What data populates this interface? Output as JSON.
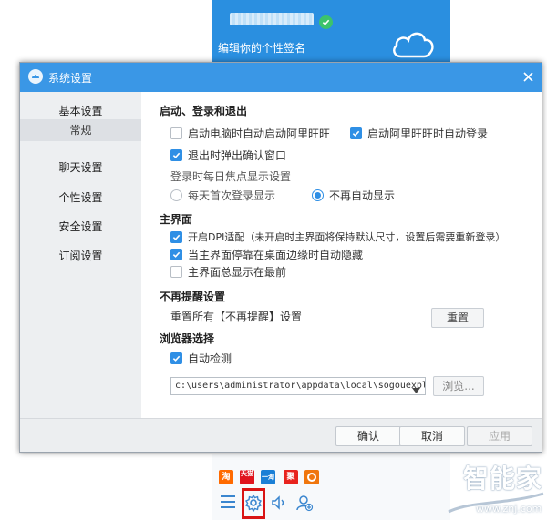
{
  "background": {
    "signature": "编辑你的个性签名",
    "apps": [
      {
        "icon": "taobao-icon",
        "label": "淘",
        "color": "#ff6a00"
      },
      {
        "icon": "tmall-icon",
        "label": "天猫",
        "color": "#e0141e"
      },
      {
        "icon": "xianyu-icon",
        "label": "一淘",
        "color": "#1a7fd6"
      },
      {
        "icon": "juhuasuan-icon",
        "label": "聚",
        "color": "#e8231e"
      },
      {
        "icon": "trip-icon",
        "label": "",
        "color": "#f0760d"
      }
    ],
    "watermark": "智能家",
    "watermark_url": "www.znj.com"
  },
  "dialog": {
    "title": "系统设置",
    "sidebar": [
      {
        "label": "基本设置"
      },
      {
        "label": "常规"
      },
      {
        "label": "聊天设置"
      },
      {
        "label": "个性设置"
      },
      {
        "label": "安全设置"
      },
      {
        "label": "订阅设置"
      }
    ],
    "sections": {
      "startup": {
        "title": "启动、登录和退出",
        "auto_start": {
          "label": "启动电脑时自动启动阿里旺旺",
          "checked": false
        },
        "auto_login": {
          "label": "启动阿里旺旺时自动登录",
          "checked": true
        },
        "exit_confirm": {
          "label": "退出时弹出确认窗口",
          "checked": true
        },
        "focus_label": "登录时每日焦点显示设置",
        "focus_daily": {
          "label": "每天首次登录显示",
          "checked": false
        },
        "focus_never": {
          "label": "不再自动显示",
          "checked": true
        }
      },
      "main_ui": {
        "title": "主界面",
        "dpi": {
          "label": "开启DPI适配（未开启时主界面将保持默认尺寸，设置后需要重新登录）",
          "checked": true
        },
        "auto_hide": {
          "label": "当主界面停靠在桌面边缘时自动隐藏",
          "checked": true
        },
        "always_top": {
          "label": "主界面总显示在最前",
          "checked": false
        }
      },
      "reminder": {
        "title": "不再提醒设置",
        "reset_label": "重置所有【不再提醒】设置",
        "reset_button": "重置"
      },
      "browser": {
        "title": "浏览器选择",
        "auto_detect": {
          "label": "自动检测",
          "checked": true
        },
        "path": "c:\\users\\administrator\\appdata\\local\\sogouexpl",
        "browse_button": "浏览..."
      }
    },
    "footer": {
      "ok": "确认",
      "cancel": "取消",
      "apply": "应用"
    }
  },
  "colors": {
    "titlebar": "#3a97e6",
    "accent": "#2f8fe5",
    "highlight": "#d91414"
  }
}
